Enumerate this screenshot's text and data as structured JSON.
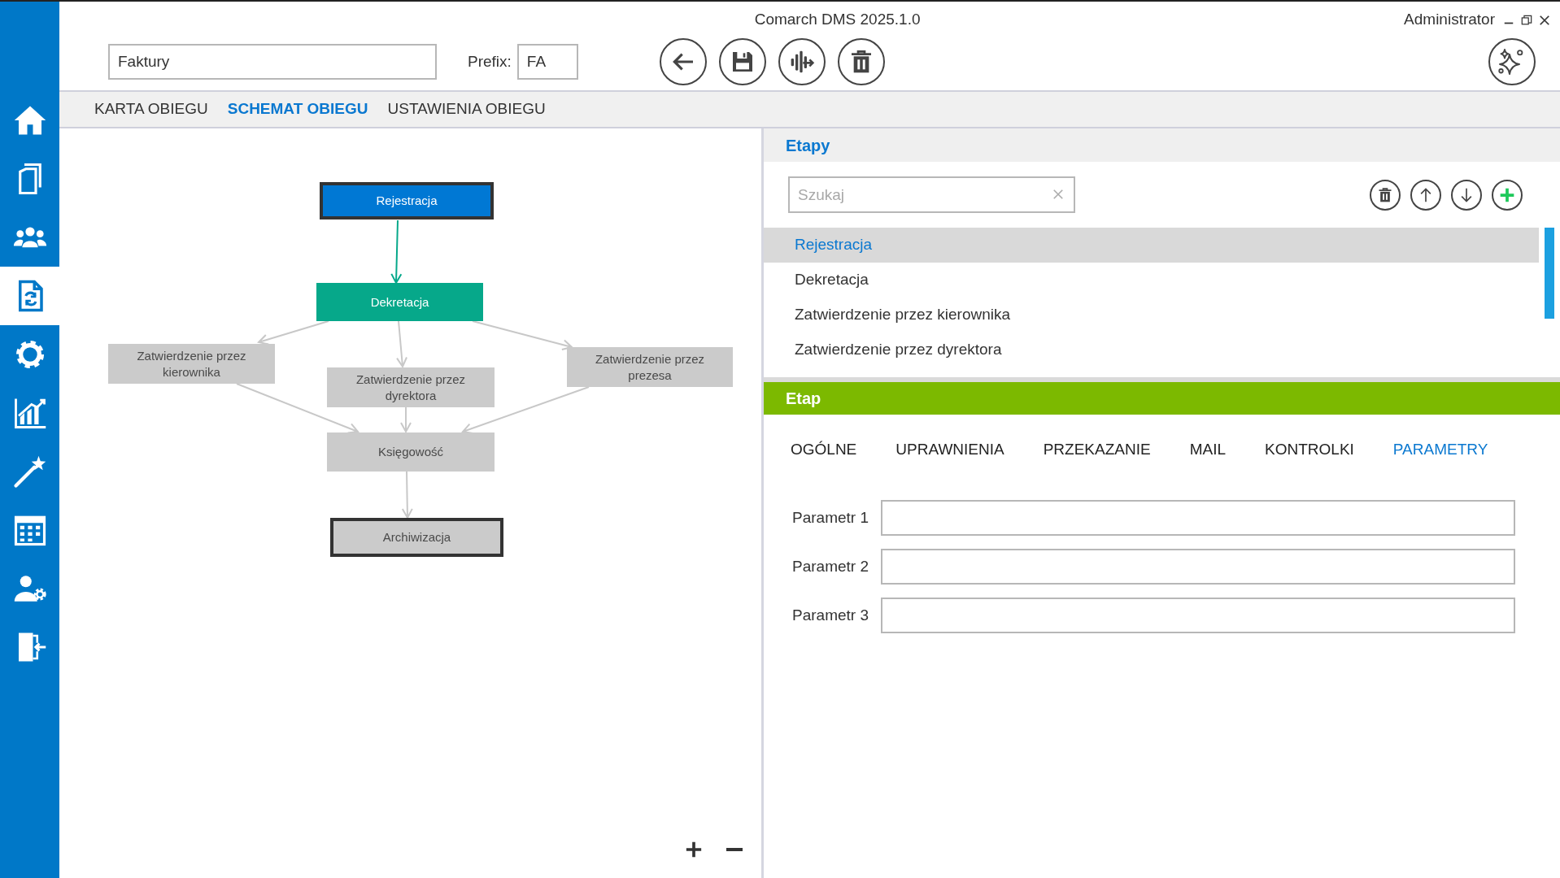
{
  "window": {
    "title": "Comarch DMS 2025.1.0",
    "user": "Administrator"
  },
  "sidebar": {
    "items": [
      {
        "kind": "home",
        "selected": false
      },
      {
        "kind": "documents",
        "selected": false
      },
      {
        "kind": "users",
        "selected": false
      },
      {
        "kind": "workflow",
        "selected": true
      },
      {
        "kind": "settings",
        "selected": false
      },
      {
        "kind": "chart",
        "selected": false
      },
      {
        "kind": "wand",
        "selected": false
      },
      {
        "kind": "calendar",
        "selected": false
      },
      {
        "kind": "user-settings",
        "selected": false
      },
      {
        "kind": "exit",
        "selected": false
      }
    ]
  },
  "header": {
    "name_field": {
      "value": "Faktury"
    },
    "prefix": {
      "label": "Prefix:",
      "value": "FA"
    }
  },
  "tabs": [
    {
      "label": "KARTA OBIEGU",
      "selected": false
    },
    {
      "label": "SCHEMAT OBIEGU",
      "selected": true
    },
    {
      "label": "USTAWIENIA OBIEGU",
      "selected": false
    }
  ],
  "diagram": {
    "nodes": [
      {
        "label": "Rejestracja",
        "color": "#0078d4",
        "outlined": true
      },
      {
        "label": "Dekretacja",
        "color": "#06a88a",
        "outlined": false
      },
      {
        "label": "Zatwierdzenie przez kierownika",
        "color": "#cbcbcb",
        "outlined": false
      },
      {
        "label": "Zatwierdzenie przez dyrektora",
        "color": "#cbcbcb",
        "outlined": false
      },
      {
        "label": "Zatwierdzenie przez prezesa",
        "color": "#cbcbcb",
        "outlined": false
      },
      {
        "label": "Księgowość",
        "color": "#cbcbcb",
        "outlined": false
      },
      {
        "label": "Archiwizacja",
        "color": "#cbcbcb",
        "outlined": true
      }
    ]
  },
  "stages": {
    "title": "Etapy",
    "search": {
      "placeholder": "Szukaj"
    },
    "items": [
      {
        "label": "Rejestracja",
        "selected": true
      },
      {
        "label": "Dekretacja",
        "selected": false
      },
      {
        "label": "Zatwierdzenie przez kierownika",
        "selected": false
      },
      {
        "label": "Zatwierdzenie przez dyrektora",
        "selected": false
      }
    ]
  },
  "stage": {
    "title": "Etap",
    "tabs": [
      {
        "label": "OGÓLNE",
        "selected": false
      },
      {
        "label": "UPRAWNIENIA",
        "selected": false
      },
      {
        "label": "PRZEKAZANIE",
        "selected": false
      },
      {
        "label": "MAIL",
        "selected": false
      },
      {
        "label": "KONTROLKI",
        "selected": false
      },
      {
        "label": "PARAMETRY",
        "selected": true
      }
    ],
    "params": [
      {
        "label": "Parametr 1"
      },
      {
        "label": "Parametr 2"
      },
      {
        "label": "Parametr 3"
      }
    ]
  }
}
